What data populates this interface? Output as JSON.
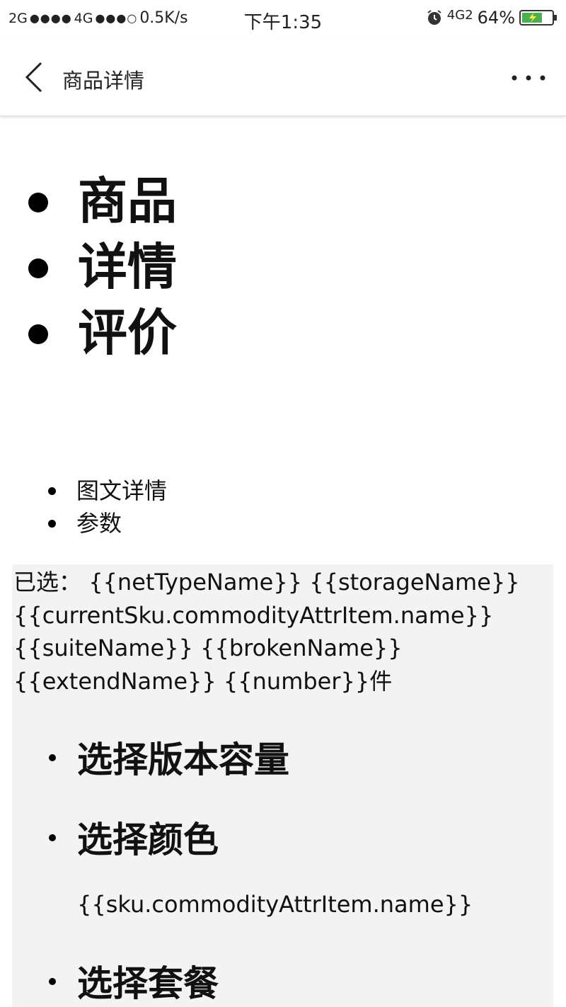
{
  "status_bar": {
    "left_2g": "2G",
    "left_signal1": "●●●●",
    "left_4g": "4G",
    "left_signal2": "●●●○",
    "speed": "0.5K/s",
    "time": "下午1:35",
    "net": "4G2",
    "battery": "64%",
    "battery_color": "#4caf50"
  },
  "title_bar": {
    "title": "商品详情"
  },
  "main_tabs": [
    "商品",
    "详情",
    "评价"
  ],
  "detail_tabs": [
    "图文详情",
    "参数"
  ],
  "panel": {
    "selected_label": "已选：",
    "selected_value": "{{netTypeName}} {{storageName}} {{currentSku.commodityAttrItem.name}} {{suiteName}} {{brokenName}} {{extendName}} {{number}}件",
    "options": [
      {
        "heading": "选择版本容量"
      },
      {
        "heading": "选择颜色",
        "item": "{{sku.commodityAttrItem.name}}"
      },
      {
        "heading": "选择套餐"
      }
    ],
    "background": "#f3f3f3"
  }
}
